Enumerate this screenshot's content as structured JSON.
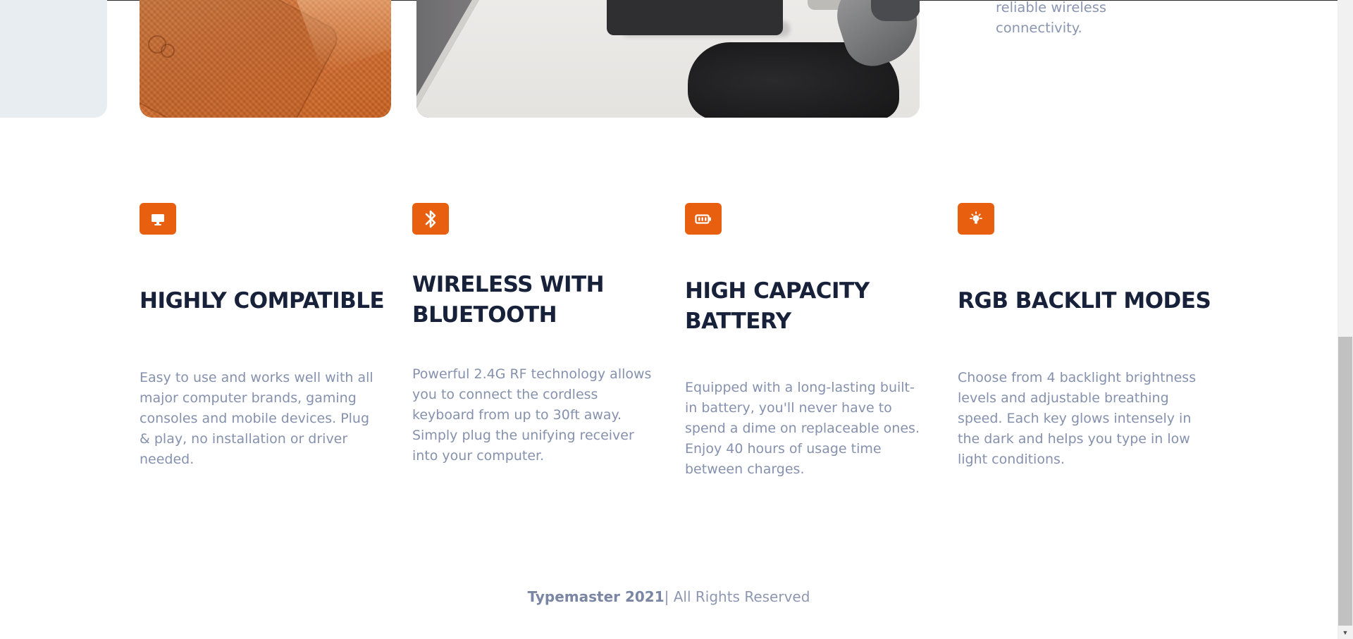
{
  "top_fragment": {
    "text_line1": "reliable wireless",
    "text_line2": "connectivity."
  },
  "features": [
    {
      "icon": "monitor-icon",
      "title": "HIGHLY COMPATIBLE",
      "description": "Easy to use and works well with all major computer brands, gaming consoles and mobile devices. Plug & play, no installation or driver needed."
    },
    {
      "icon": "bluetooth-icon",
      "title": "WIRELESS WITH BLUETOOTH",
      "description": "Powerful 2.4G RF technology allows you to connect the cordless keyboard from up to 30ft away. Simply plug the unifying receiver into your computer."
    },
    {
      "icon": "battery-icon",
      "title": "HIGH CAPACITY BATTERY",
      "description": "Equipped with a long-lasting built-in battery, you'll never have to spend a dime on replaceable ones.  Enjoy 40 hours of usage time between charges."
    },
    {
      "icon": "lightbulb-icon",
      "title": "RGB BACKLIT MODES",
      "description": "Choose from 4 backlight brightness levels and adjustable breathing speed. Each key glows intensely in the dark and helps you type in low light conditions."
    }
  ],
  "footer": {
    "brand": "Typemaster 2021",
    "rights": "| All Rights Reserved"
  },
  "colors": {
    "accent": "#e8600f",
    "heading": "#17213a",
    "body_text": "#8591ad"
  }
}
